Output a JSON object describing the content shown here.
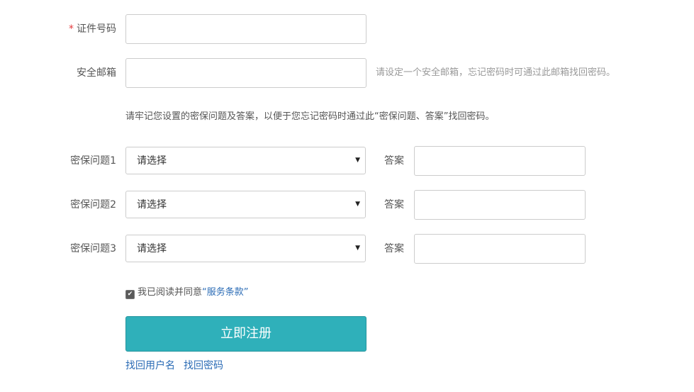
{
  "form": {
    "id_number": {
      "required_mark": "*",
      "label": "证件号码",
      "value": ""
    },
    "email": {
      "label": "安全邮箱",
      "value": "",
      "hint": "请设定一个安全邮箱，忘记密码时可通过此邮箱找回密码。"
    },
    "security_notice": "请牢记您设置的密保问题及答案，以便于您忘记密码时通过此“密保问题、答案”找回密码。",
    "security_questions": [
      {
        "label": "密保问题1",
        "selected": "请选择",
        "answer_label": "答案",
        "answer_value": ""
      },
      {
        "label": "密保问题2",
        "selected": "请选择",
        "answer_label": "答案",
        "answer_value": ""
      },
      {
        "label": "密保问题3",
        "selected": "请选择",
        "answer_label": "答案",
        "answer_value": ""
      }
    ],
    "agreement": {
      "checked": true,
      "text": "我已阅读并同意",
      "link": "“服务条款”"
    },
    "submit_label": "立即注册",
    "links": {
      "find_username": "找回用户名",
      "find_password": "找回密码"
    }
  },
  "colors": {
    "primary_button": "#2fb0ba",
    "link": "#2a6bb5",
    "required": "#e4393c",
    "hint": "#999999"
  }
}
